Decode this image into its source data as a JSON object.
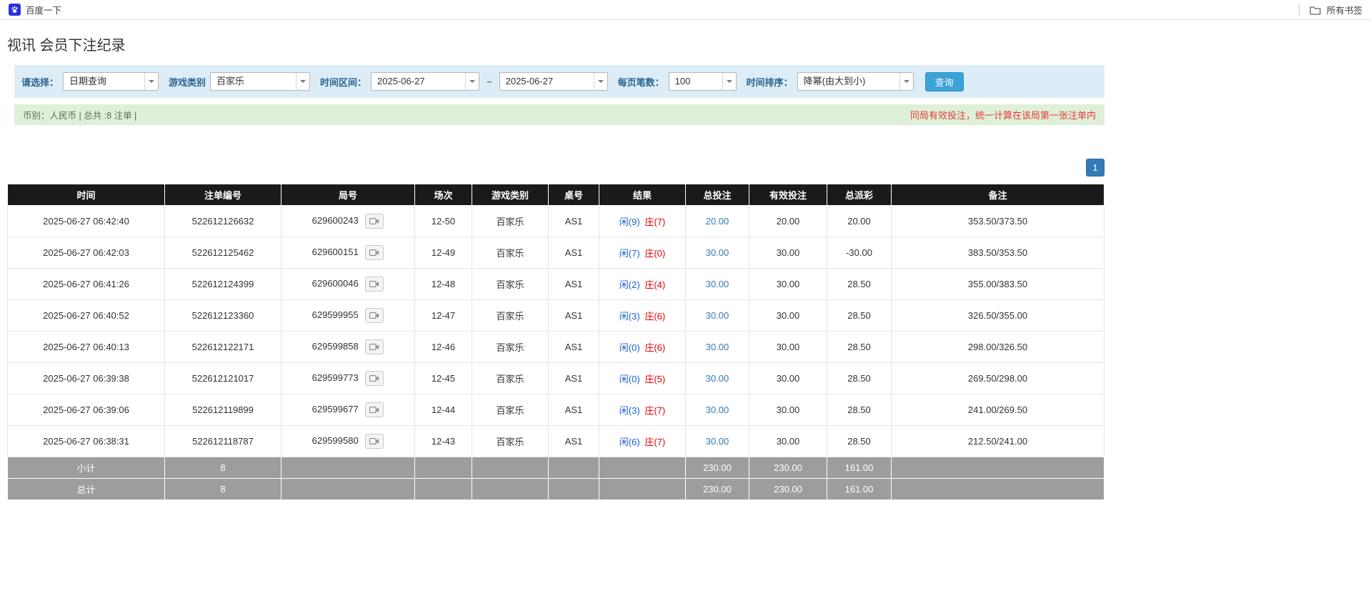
{
  "bookmarks_bar": {
    "baidu_label": "百度一下",
    "all_bookmarks_label": "所有书签"
  },
  "page": {
    "title": "视讯 会员下注纪录"
  },
  "filters": {
    "select_label": "请选择：",
    "select_value": "日期查询",
    "game_type_label": "游戏类别",
    "game_type_value": "百家乐",
    "date_range_label": "时间区间：",
    "date_from": "2025-06-27",
    "date_separator": "~",
    "date_to": "2025-06-27",
    "page_size_label": "每页笔数：",
    "page_size_value": "100",
    "sort_label": "时间排序：",
    "sort_value": "降幂(由大到小)",
    "search_button": "查询"
  },
  "summary": {
    "left_text": "币别：人民币 | 总共 :8 注单 |",
    "right_text": "同局有效投注，统一计算在该局第一张注单内"
  },
  "pagination": {
    "current_page": "1"
  },
  "icons": {
    "baidu_logo": "baidu-logo-icon",
    "bookmarks_folder": "folder-icon",
    "combo_arrow": "chevron-down-icon",
    "round_video": "video-camera-icon"
  },
  "colors": {
    "filter_bar_bg": "#ddedf7",
    "summary_bar_bg": "#dff0d8",
    "search_button_bg": "#3ba2d8",
    "table_header_bg": "#1a1a1a",
    "footer_row_bg": "#9d9d9d",
    "link_blue": "#337ab7",
    "player_blue": "#1a5fd0",
    "banker_red": "#e60000",
    "negative_red": "#e60000",
    "notice_red": "#e43b3b"
  },
  "table": {
    "headers": [
      "时间",
      "注单编号",
      "局号",
      "场次",
      "游戏类别",
      "桌号",
      "结果",
      "总投注",
      "有效投注",
      "总派彩",
      "备注"
    ],
    "rows": [
      {
        "time": "2025-06-27 06:42:40",
        "bet_id": "522612126632",
        "round_id": "629600243",
        "session": "12-50",
        "game": "百家乐",
        "table_no": "AS1",
        "result_player": "闲(9)",
        "result_banker": "庄(7)",
        "total_bet": "20.00",
        "valid_bet": "20.00",
        "payout": "20.00",
        "note": "353.50/373.50"
      },
      {
        "time": "2025-06-27 06:42:03",
        "bet_id": "522612125462",
        "round_id": "629600151",
        "session": "12-49",
        "game": "百家乐",
        "table_no": "AS1",
        "result_player": "闲(7)",
        "result_banker": "庄(0)",
        "total_bet": "30.00",
        "valid_bet": "30.00",
        "payout": "-30.00",
        "note": "383.50/353.50"
      },
      {
        "time": "2025-06-27 06:41:26",
        "bet_id": "522612124399",
        "round_id": "629600046",
        "session": "12-48",
        "game": "百家乐",
        "table_no": "AS1",
        "result_player": "闲(2)",
        "result_banker": "庄(4)",
        "total_bet": "30.00",
        "valid_bet": "30.00",
        "payout": "28.50",
        "note": "355.00/383.50"
      },
      {
        "time": "2025-06-27 06:40:52",
        "bet_id": "522612123360",
        "round_id": "629599955",
        "session": "12-47",
        "game": "百家乐",
        "table_no": "AS1",
        "result_player": "闲(3)",
        "result_banker": "庄(6)",
        "total_bet": "30.00",
        "valid_bet": "30.00",
        "payout": "28.50",
        "note": "326.50/355.00"
      },
      {
        "time": "2025-06-27 06:40:13",
        "bet_id": "522612122171",
        "round_id": "629599858",
        "session": "12-46",
        "game": "百家乐",
        "table_no": "AS1",
        "result_player": "闲(0)",
        "result_banker": "庄(6)",
        "total_bet": "30.00",
        "valid_bet": "30.00",
        "payout": "28.50",
        "note": "298.00/326.50"
      },
      {
        "time": "2025-06-27 06:39:38",
        "bet_id": "522612121017",
        "round_id": "629599773",
        "session": "12-45",
        "game": "百家乐",
        "table_no": "AS1",
        "result_player": "闲(0)",
        "result_banker": "庄(5)",
        "total_bet": "30.00",
        "valid_bet": "30.00",
        "payout": "28.50",
        "note": "269.50/298.00"
      },
      {
        "time": "2025-06-27 06:39:06",
        "bet_id": "522612119899",
        "round_id": "629599677",
        "session": "12-44",
        "game": "百家乐",
        "table_no": "AS1",
        "result_player": "闲(3)",
        "result_banker": "庄(7)",
        "total_bet": "30.00",
        "valid_bet": "30.00",
        "payout": "28.50",
        "note": "241.00/269.50"
      },
      {
        "time": "2025-06-27 06:38:31",
        "bet_id": "522612118787",
        "round_id": "629599580",
        "session": "12-43",
        "game": "百家乐",
        "table_no": "AS1",
        "result_player": "闲(6)",
        "result_banker": "庄(7)",
        "total_bet": "30.00",
        "valid_bet": "30.00",
        "payout": "28.50",
        "note": "212.50/241.00"
      }
    ],
    "subtotal": {
      "label": "小计",
      "count": "8",
      "total_bet": "230.00",
      "valid_bet": "230.00",
      "payout": "161.00"
    },
    "total": {
      "label": "总计",
      "count": "8",
      "total_bet": "230.00",
      "valid_bet": "230.00",
      "payout": "161.00"
    }
  }
}
